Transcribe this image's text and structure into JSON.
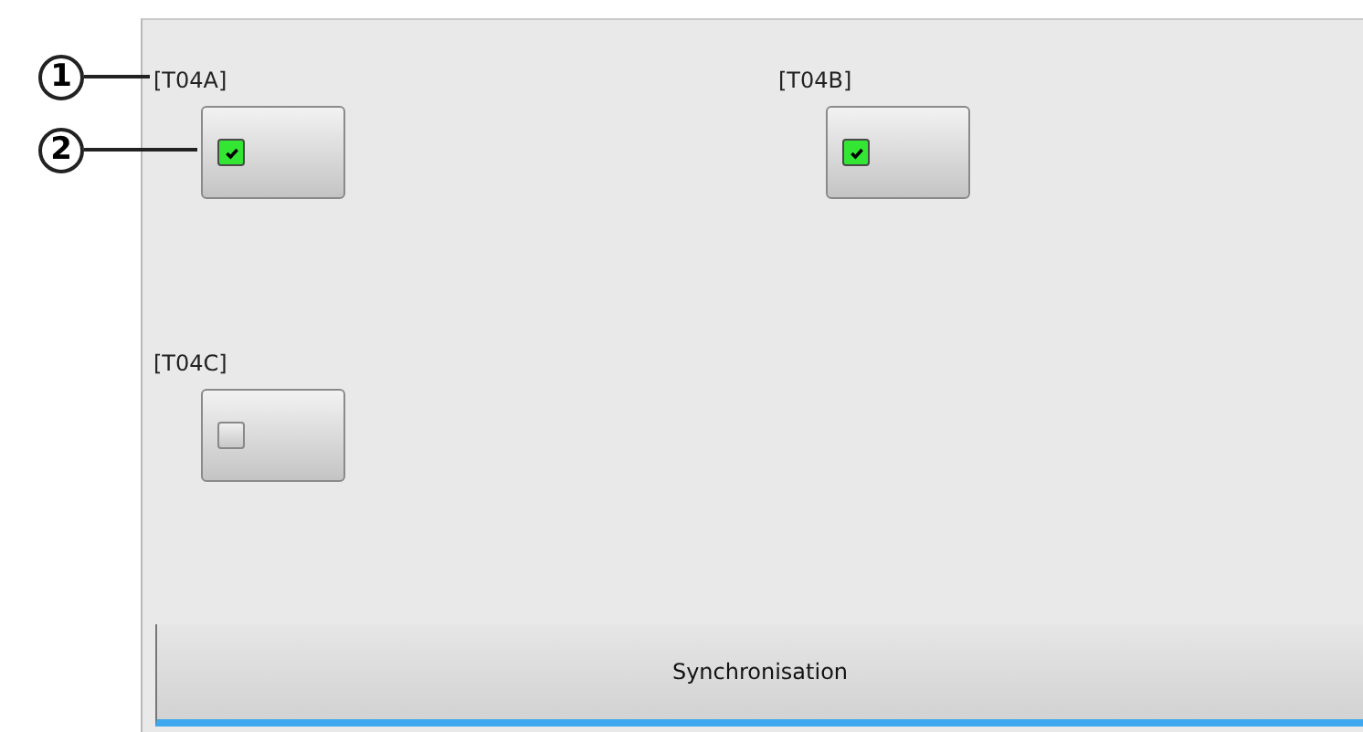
{
  "callouts": [
    {
      "label": "1"
    },
    {
      "label": "2"
    }
  ],
  "toggles": [
    {
      "label": "[T04A]",
      "checked": true
    },
    {
      "label": "[T04B]",
      "checked": true
    },
    {
      "label": "[T04C]",
      "checked": false
    }
  ],
  "footer_button": {
    "label": "Synchronisation"
  }
}
